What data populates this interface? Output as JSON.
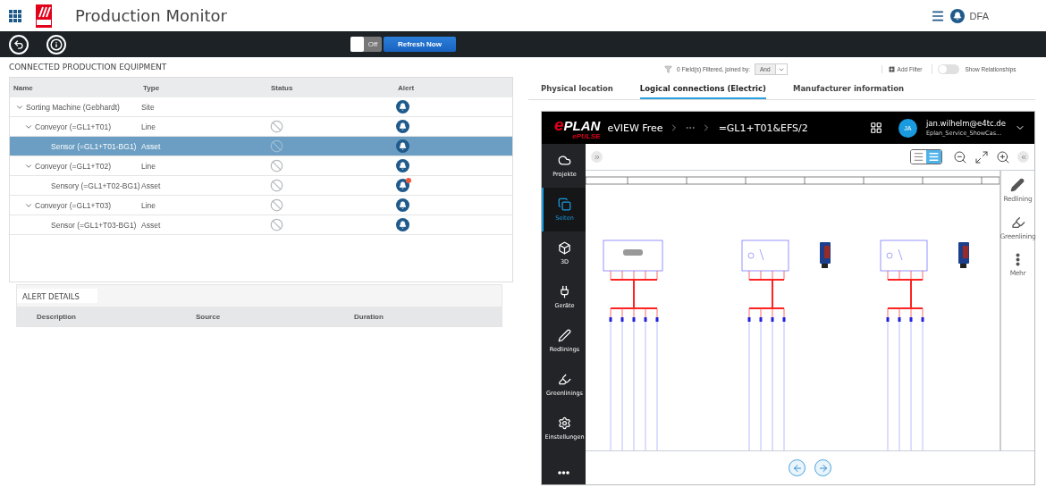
{
  "app": {
    "title": "Production Monitor",
    "user": "DFA"
  },
  "toolbar": {
    "auto_refresh": {
      "label": "Off",
      "on": false
    },
    "refresh_button": "Refresh Now"
  },
  "equipment": {
    "title": "CONNECTED PRODUCTION EQUIPMENT",
    "columns": [
      "Name",
      "Type",
      "Status",
      "Alert"
    ],
    "rows": [
      {
        "name": "Sorting Machine (Gebhardt)",
        "type": "Site",
        "blocked": false,
        "alert_unread": false,
        "selected": false,
        "expanded": true,
        "children": [
          {
            "name": "Conveyor (=GL1+T01)",
            "type": "Line",
            "blocked": true,
            "alert_unread": false,
            "selected": false,
            "expanded": true,
            "children": [
              {
                "name": "Sensor (=GL1+T01-BG1)",
                "type": "Asset",
                "blocked": true,
                "alert_unread": false,
                "selected": true
              }
            ]
          },
          {
            "name": "Conveyor (=GL1+T02)",
            "type": "Line",
            "blocked": true,
            "alert_unread": false,
            "selected": false,
            "expanded": true,
            "children": [
              {
                "name": "Sensory (=GL1+T02-BG1)",
                "type": "Asset",
                "blocked": true,
                "alert_unread": true,
                "selected": false
              }
            ]
          },
          {
            "name": "Conveyor (=GL1+T03)",
            "type": "Line",
            "blocked": true,
            "alert_unread": false,
            "selected": false,
            "expanded": true,
            "children": [
              {
                "name": "Sensor (=GL1+T03-BG1)",
                "type": "Asset",
                "blocked": true,
                "alert_unread": false,
                "selected": false
              }
            ]
          }
        ]
      }
    ]
  },
  "alert_details": {
    "title": "ALERT DETAILS",
    "columns": [
      "Description",
      "Source",
      "Duration"
    ]
  },
  "filter": {
    "summary": "0 Field(s) Filtered, joined by:",
    "join": "And",
    "add_filter": "Add Filter",
    "show_relationships": {
      "label": "Show Relationships",
      "on": false
    }
  },
  "tabs": [
    {
      "label": "Physical location",
      "selected": false
    },
    {
      "label": "Logical connections (Electric)",
      "selected": true
    },
    {
      "label": "Manufacturer information",
      "selected": false
    }
  ],
  "viewer": {
    "logo": {
      "main": "ePLAN",
      "sub": "ePULSE"
    },
    "app_name": "eVIEW Free",
    "page": "=GL1+T01&EFS/2",
    "user": {
      "initials": "JA",
      "email": "jan.wilhelm@e4tc.de",
      "project": "Eplan_Service_ShowCas..."
    },
    "sidebar": [
      {
        "label": "Projekte",
        "kind": "cloud",
        "selected": false
      },
      {
        "label": "Seiten",
        "kind": "pages",
        "selected": true
      },
      {
        "label": "3D",
        "kind": "cube",
        "selected": false
      },
      {
        "label": "Geräte",
        "kind": "plug",
        "selected": false
      },
      {
        "label": "Redlinings",
        "kind": "pen",
        "selected": false
      },
      {
        "label": "Greenlinings",
        "kind": "highlighter",
        "selected": false
      },
      {
        "label": "Einstellungen",
        "kind": "gear",
        "selected": false
      }
    ],
    "view_modes": [
      {
        "kind": "single",
        "selected": false
      },
      {
        "kind": "double",
        "selected": true
      }
    ],
    "tools": [
      {
        "label": "Redlining",
        "kind": "marker"
      },
      {
        "label": "Greenlining",
        "kind": "highlighter"
      },
      {
        "label": "Mehr",
        "kind": "dots"
      }
    ]
  }
}
